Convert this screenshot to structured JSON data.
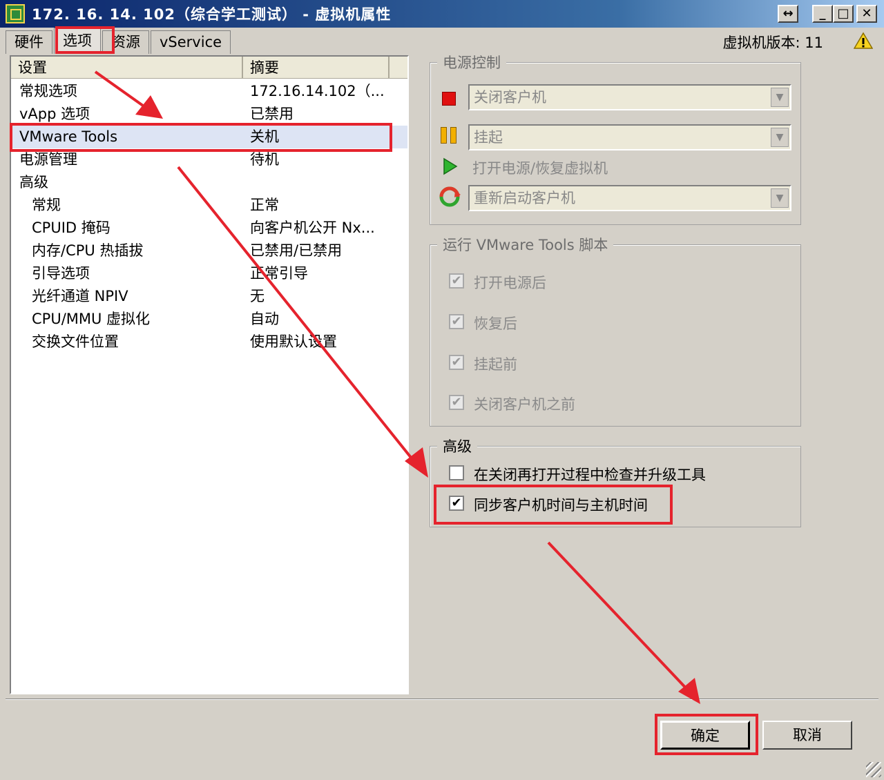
{
  "window": {
    "title": "172. 16. 14. 102（综合学工测试） - 虚拟机属性",
    "restore_glyph": "↔",
    "minimize_glyph": "_",
    "maximize_glyph": "□",
    "close_glyph": "✕"
  },
  "tabs": [
    {
      "label": "硬件"
    },
    {
      "label": "选项"
    },
    {
      "label": "资源"
    },
    {
      "label": "vService"
    }
  ],
  "vm_version": "虚拟机版本: 11",
  "list": {
    "header_setting": "设置",
    "header_summary": "摘要",
    "rows": [
      {
        "setting": "常规选项",
        "summary": "172.16.14.102（..."
      },
      {
        "setting": "vApp 选项",
        "summary": "已禁用"
      },
      {
        "setting": "VMware Tools",
        "summary": "关机"
      },
      {
        "setting": "电源管理",
        "summary": "待机"
      },
      {
        "setting": "高级",
        "summary": ""
      },
      {
        "setting": "常规",
        "summary": "正常"
      },
      {
        "setting": "CPUID 掩码",
        "summary": "向客户机公开 Nx..."
      },
      {
        "setting": "内存/CPU 热插拔",
        "summary": "已禁用/已禁用"
      },
      {
        "setting": "引导选项",
        "summary": "正常引导"
      },
      {
        "setting": "光纤通道 NPIV",
        "summary": "无"
      },
      {
        "setting": "CPU/MMU 虚拟化",
        "summary": "自动"
      },
      {
        "setting": "交换文件位置",
        "summary": "使用默认设置"
      }
    ]
  },
  "power_control": {
    "title": "电源控制",
    "stop_select": "关闭客户机",
    "suspend_select": "挂起",
    "power_on_text": "打开电源/恢复虚拟机",
    "restart_select": "重新启动客户机",
    "dropdown_glyph": "▼"
  },
  "scripts": {
    "title": "运行 VMware Tools 脚本",
    "items": [
      {
        "label": "打开电源后",
        "checked": true
      },
      {
        "label": "恢复后",
        "checked": true
      },
      {
        "label": "挂起前",
        "checked": true
      },
      {
        "label": "关闭客户机之前",
        "checked": true
      }
    ]
  },
  "advanced": {
    "title": "高级",
    "check_upgrade": "在关闭再打开过程中检查并升级工具",
    "sync_time": "同步客户机时间与主机时间",
    "check_glyph": "✔"
  },
  "buttons": {
    "ok": "确定",
    "cancel": "取消"
  },
  "colors": {
    "highlight": "#e5232d",
    "title_bar": "#0a246a",
    "dialog_bg": "#d4d0c8"
  }
}
